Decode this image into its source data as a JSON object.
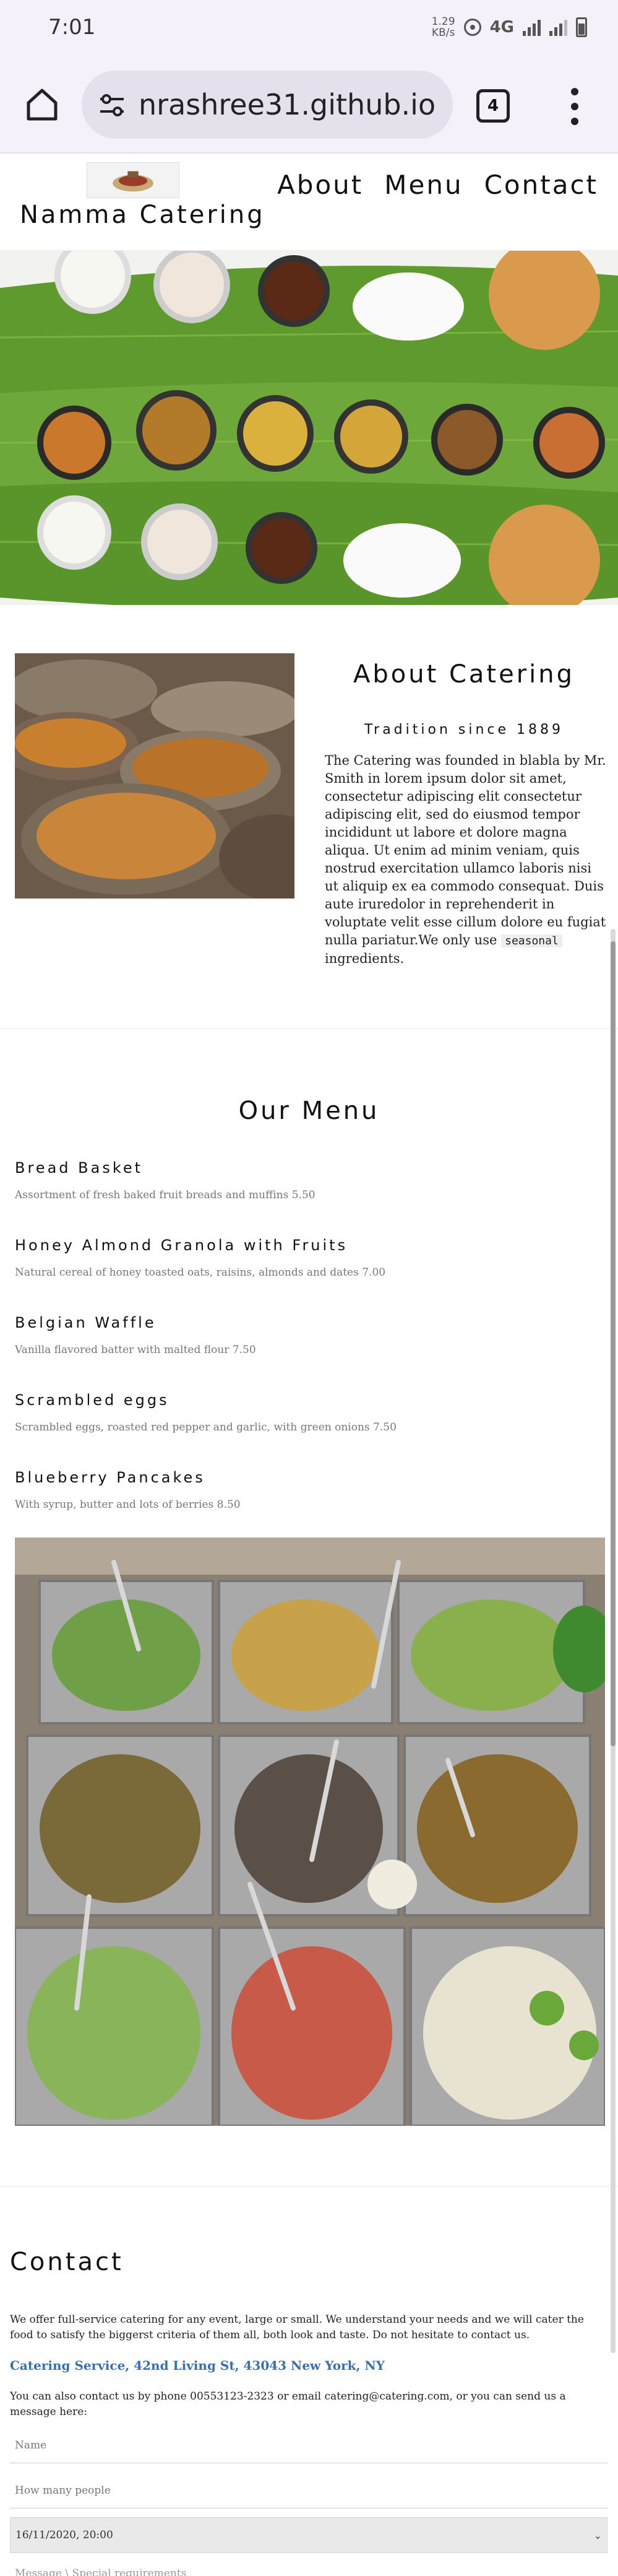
{
  "status_bar": {
    "time": "7:01",
    "speed_value": "1.29",
    "speed_unit": "KB/s",
    "network": "4G"
  },
  "browser": {
    "url": "nrashree31.github.io",
    "tab_count": "4",
    "icons": [
      "home-icon",
      "site-settings-icon",
      "tabs-icon",
      "more-vert-icon"
    ]
  },
  "site": {
    "brand": "Namma Catering",
    "nav": [
      "About",
      "Menu",
      "Contact"
    ]
  },
  "about": {
    "title": "About Catering",
    "subtitle": "Tradition since 1889",
    "text": "The Catering was founded in blabla by Mr. Smith in lorem ipsum dolor sit amet, consectetur adipiscing elit consectetur adipiscing elit, sed do eiusmod tempor incididunt ut labore et dolore magna aliqua. Ut enim ad minim veniam, quis nostrud exercitation ullamco laboris nisi ut aliquip ex ea commodo consequat. Duis aute iruredolor in reprehenderit in voluptate velit esse cillum dolore eu fugiat nulla pariatur.We only use",
    "tag": "seasonal",
    "text_end": "ingredients."
  },
  "menu": {
    "title": "Our Menu",
    "items": [
      {
        "name": "Bread Basket",
        "desc": "Assortment of fresh baked fruit breads and muffins 5.50"
      },
      {
        "name": "Honey Almond Granola with Fruits",
        "desc": "Natural cereal of honey toasted oats, raisins, almonds and dates 7.00"
      },
      {
        "name": "Belgian Waffle",
        "desc": "Vanilla flavored batter with malted flour 7.50"
      },
      {
        "name": "Scrambled eggs",
        "desc": "Scrambled eggs, roasted red pepper and garlic, with green onions 7.50"
      },
      {
        "name": "Blueberry Pancakes",
        "desc": "With syrup, butter and lots of berries 8.50"
      }
    ]
  },
  "contact": {
    "title": "Contact",
    "intro": "We offer full-service catering for any event, large or small. We understand your needs and we will cater the food to satisfy the biggerst criteria of them all, both look and taste. Do not hesitate to contact us.",
    "address": "Catering Service, 42nd Living St, 43043 New York, NY",
    "phone_text": "You can also contact us by phone 00553123-2323 or email catering@catering.com, or you can send us a message here:",
    "name_placeholder": "Name",
    "people_placeholder": "How many people",
    "datetime_value": "16/11/2020, 20:00",
    "message_placeholder": "Message \\ Special requirements"
  },
  "colors": {
    "address": "#3b6fa8",
    "browser_bg": "#f5f0fa",
    "url_pill": "#e6e0ec"
  }
}
